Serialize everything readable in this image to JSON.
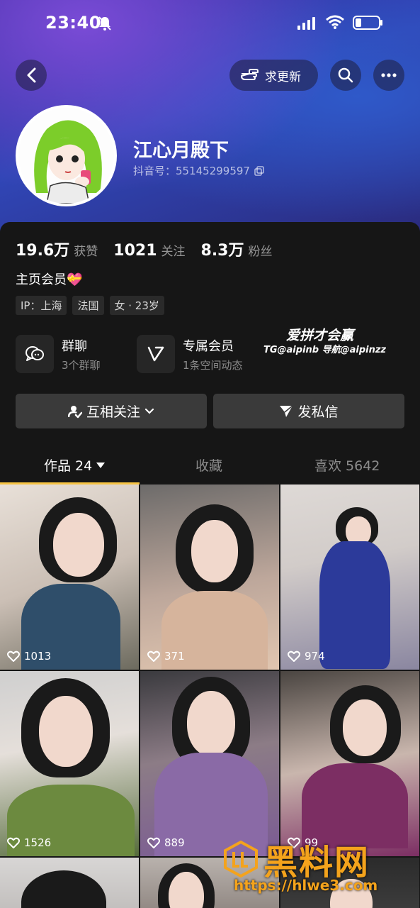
{
  "status_bar": {
    "time": "23:40"
  },
  "header": {
    "update_label": "求更新",
    "nickname": "江心月殿下",
    "douyin_id": "抖音号：55145299597"
  },
  "stats": [
    {
      "num": "19.6万",
      "label": "获赞"
    },
    {
      "num": "1021",
      "label": "关注"
    },
    {
      "num": "8.3万",
      "label": "粉丝"
    }
  ],
  "bio": "主页会员💝",
  "tags": [
    "IP：上海",
    "法国",
    "女 · 23岁"
  ],
  "features": [
    {
      "title": "群聊",
      "sub": "3个群聊",
      "icon": "chat-bubbles-icon"
    },
    {
      "title": "专属会员",
      "sub": "1条空间动态",
      "icon": "v-badge-icon"
    }
  ],
  "watermark": {
    "line1": "爱拼才会赢",
    "line2": "TG@aipinb 导航@aipinzz"
  },
  "actions": {
    "follow": "互相关注",
    "message": "发私信"
  },
  "tabs": {
    "works": "作品 24",
    "favorites": "收藏",
    "likes": "喜欢 5642"
  },
  "grid": {
    "items": [
      {
        "likes": "1013"
      },
      {
        "likes": "371"
      },
      {
        "likes": "974"
      },
      {
        "likes": "1526"
      },
      {
        "likes": "889"
      },
      {
        "likes": "99"
      }
    ]
  },
  "site_watermark": {
    "brand": "黑料网",
    "url": "https://hlwe3.com"
  },
  "colors": {
    "accent": "#f6c343",
    "panel": "#161616",
    "brand_orange": "#f4a31c"
  }
}
